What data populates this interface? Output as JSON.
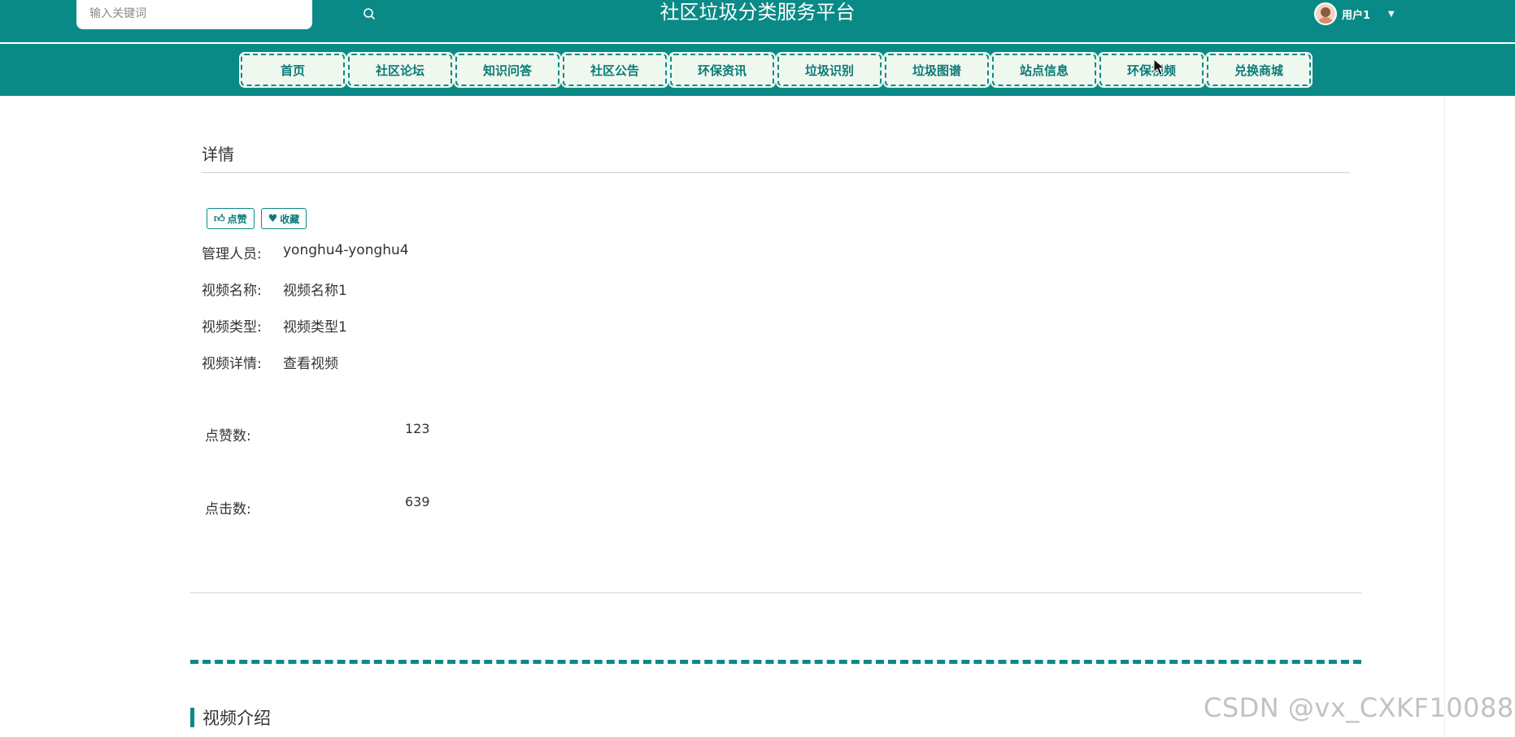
{
  "header": {
    "site_title": "社区垃圾分类服务平台",
    "search": {
      "placeholder": "输入关键词"
    },
    "user": {
      "name": "用户1"
    }
  },
  "nav": {
    "items": [
      {
        "label": "首页"
      },
      {
        "label": "社区论坛"
      },
      {
        "label": "知识问答"
      },
      {
        "label": "社区公告"
      },
      {
        "label": "环保资讯"
      },
      {
        "label": "垃圾识别"
      },
      {
        "label": "垃圾图谱"
      },
      {
        "label": "站点信息"
      },
      {
        "label": "环保视频"
      },
      {
        "label": "兑换商城"
      }
    ]
  },
  "detail": {
    "title": "详情",
    "actions": {
      "like_label": "点赞",
      "favorite_label": "收藏"
    },
    "fields": [
      {
        "label": "管理人员:",
        "value": "yonghu4-yonghu4"
      },
      {
        "label": "视频名称:",
        "value": "视频名称1"
      },
      {
        "label": "视频类型:",
        "value": "视频类型1"
      },
      {
        "label": "视频详情:",
        "value": "查看视频"
      }
    ],
    "stats": {
      "likes_label": "点赞数:",
      "likes_value": "123",
      "clicks_label": "点击数:",
      "clicks_value": "639"
    },
    "section_title": "视频介绍"
  },
  "watermark": "CSDN @vx_CXKF10088",
  "colors": {
    "primary": "#0a8a86",
    "nav_item_bg": "#eef8ef"
  }
}
